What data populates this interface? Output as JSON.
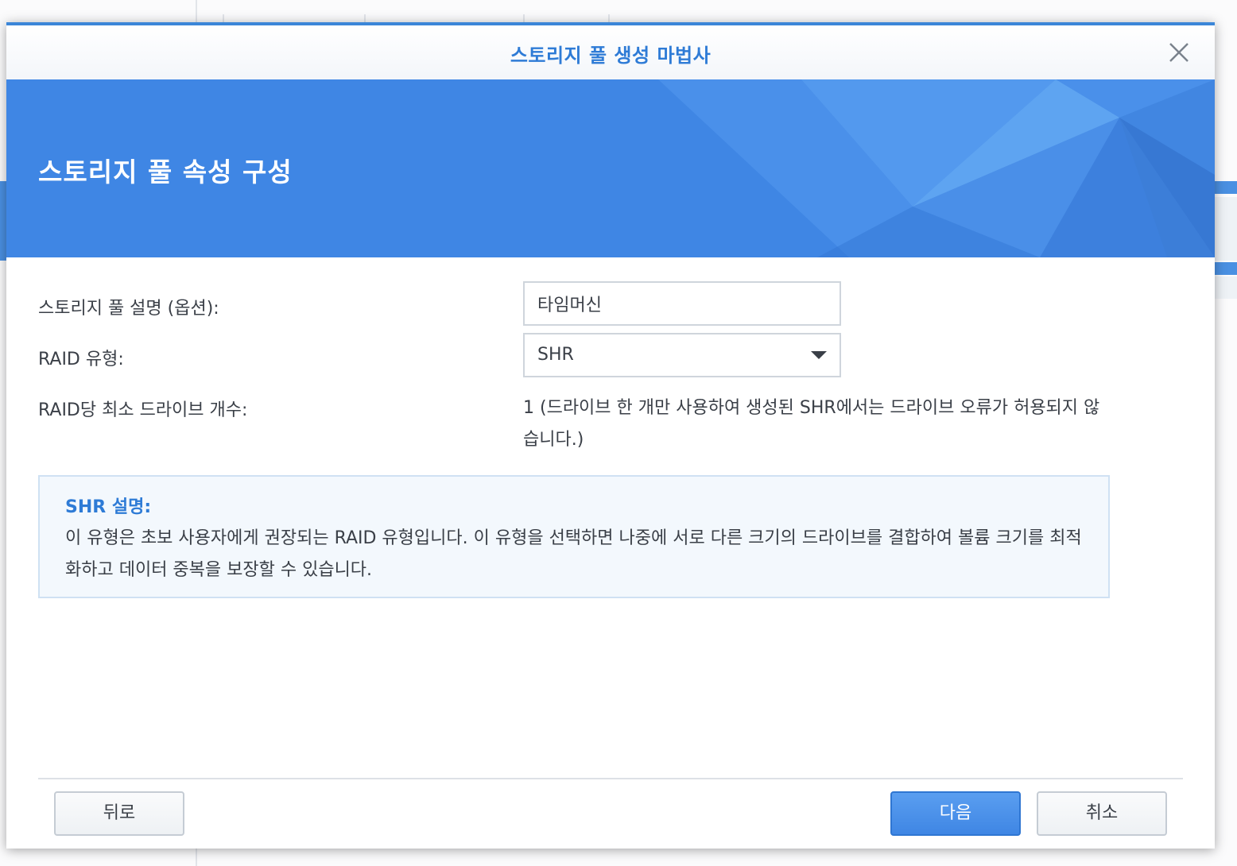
{
  "dialog": {
    "title": "스토리지 풀 생성 마법사",
    "close_icon": "close-icon",
    "accent_color": "#3f86e4"
  },
  "banner": {
    "title": "스토리지 풀 속성 구성"
  },
  "form": {
    "description": {
      "label": "스토리지 풀 설명 (옵션):",
      "value": "타임머신"
    },
    "raid_type": {
      "label": "RAID 유형:",
      "selected": "SHR"
    },
    "min_drives": {
      "label": "RAID당 최소 드라이브 개수:",
      "value": "1 (드라이브 한 개만 사용하여 생성된 SHR에서는 드라이브 오류가 허용되지 않습니다.)"
    }
  },
  "info": {
    "title": "SHR 설명:",
    "body": "이 유형은 초보 사용자에게 권장되는 RAID 유형입니다. 이 유형을 선택하면 나중에 서로 다른 크기의 드라이브를 결합하여 볼륨 크기를 최적화하고 데이터 중복을 보장할 수 있습니다."
  },
  "footer": {
    "back_label": "뒤로",
    "next_label": "다음",
    "cancel_label": "취소"
  }
}
